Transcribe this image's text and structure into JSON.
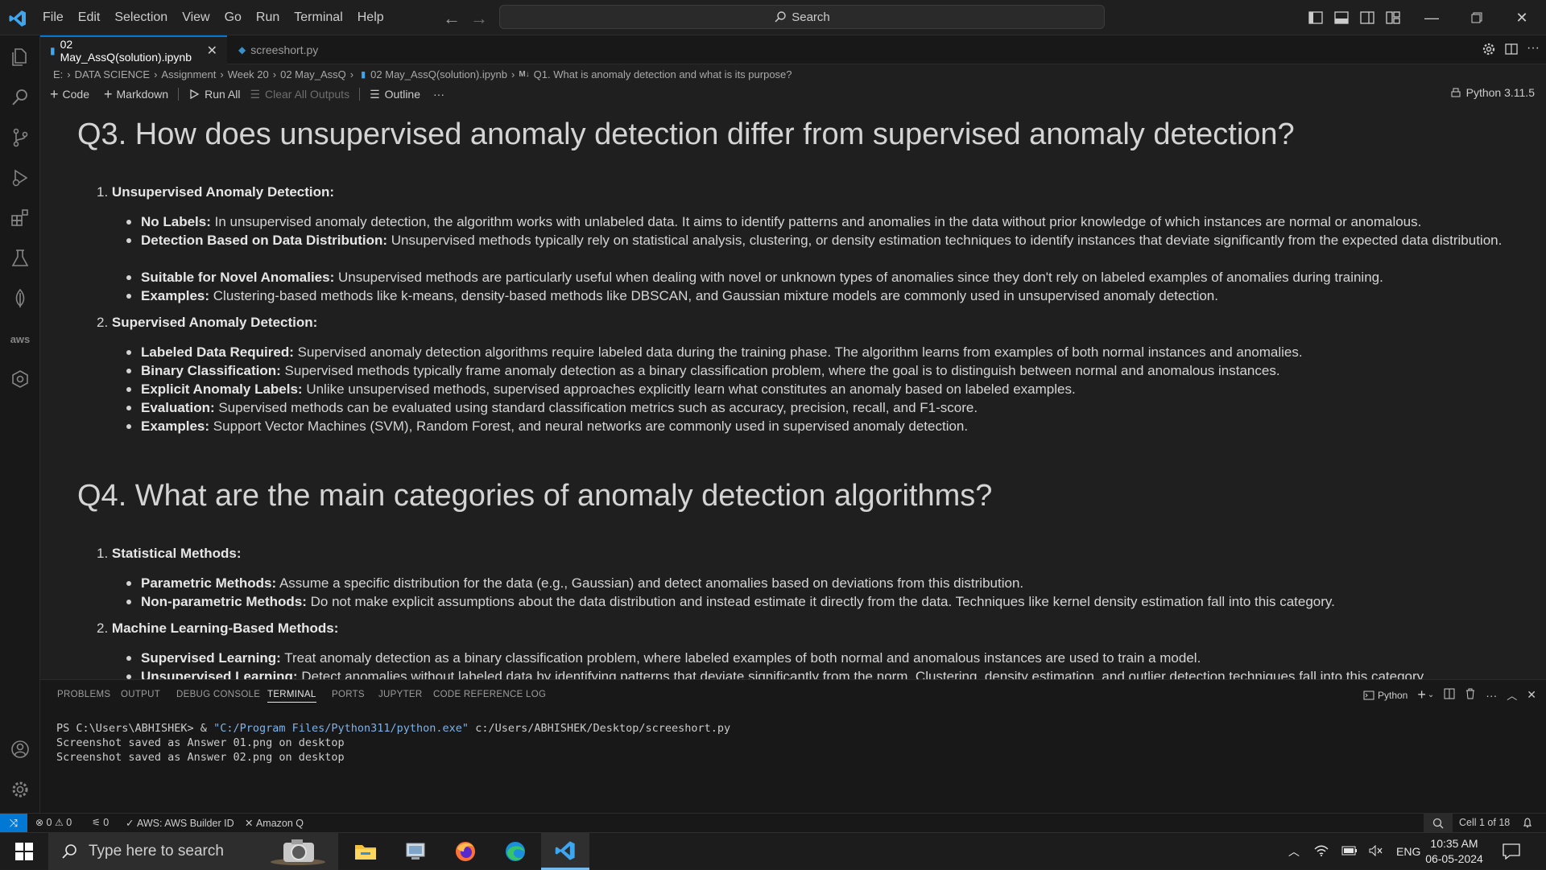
{
  "menu": [
    "File",
    "Edit",
    "Selection",
    "View",
    "Go",
    "Run",
    "Terminal",
    "Help"
  ],
  "search": {
    "label": "Search"
  },
  "tabs": [
    {
      "label": "02 May_AssQ(solution).ipynb"
    },
    {
      "label": "screeshort.py"
    }
  ],
  "breadcrumb": [
    "E:",
    "DATA SCIENCE",
    "Assignment",
    "Week 20",
    "02 May_AssQ",
    "02 May_AssQ(solution).ipynb",
    "Q1. What is anomaly detection and what is its purpose?"
  ],
  "breadcrumb_md_badge": "M↓",
  "toolbar": {
    "code": "Code",
    "markdown": "Markdown",
    "run_all": "Run All",
    "clear_outputs": "Clear All Outputs",
    "outline": "Outline",
    "more": "···",
    "kernel": "Python 3.11.5"
  },
  "content": {
    "q3": {
      "title": "Q3. How does unsupervised anomaly detection differ from supervised anomaly detection?",
      "sections": [
        {
          "num": "1.",
          "heading": "Unsupervised Anomaly Detection:",
          "items": [
            {
              "term": "No Labels:",
              "text": " In unsupervised anomaly detection, the algorithm works with unlabeled data. It aims to identify patterns and anomalies in the data without prior knowledge of which instances are normal or anomalous."
            },
            {
              "term": "Detection Based on Data Distribution:",
              "text": " Unsupervised methods typically rely on statistical analysis, clustering, or density estimation techniques to identify instances that deviate significantly from the expected data distribution."
            },
            {
              "term": "Suitable for Novel Anomalies:",
              "text": " Unsupervised methods are particularly useful when dealing with novel or unknown types of anomalies since they don't rely on labeled examples of anomalies during training."
            },
            {
              "term": "Examples:",
              "text": " Clustering-based methods like k-means, density-based methods like DBSCAN, and Gaussian mixture models are commonly used in unsupervised anomaly detection."
            }
          ]
        },
        {
          "num": "2.",
          "heading": "Supervised Anomaly Detection:",
          "items": [
            {
              "term": "Labeled Data Required:",
              "text": " Supervised anomaly detection algorithms require labeled data during the training phase. The algorithm learns from examples of both normal instances and anomalies."
            },
            {
              "term": "Binary Classification:",
              "text": " Supervised methods typically frame anomaly detection as a binary classification problem, where the goal is to distinguish between normal and anomalous instances."
            },
            {
              "term": "Explicit Anomaly Labels:",
              "text": " Unlike unsupervised methods, supervised approaches explicitly learn what constitutes an anomaly based on labeled examples."
            },
            {
              "term": "Evaluation:",
              "text": " Supervised methods can be evaluated using standard classification metrics such as accuracy, precision, recall, and F1-score."
            },
            {
              "term": "Examples:",
              "text": " Support Vector Machines (SVM), Random Forest, and neural networks are commonly used in supervised anomaly detection."
            }
          ]
        }
      ]
    },
    "q4": {
      "title": "Q4. What are the main categories of anomaly detection algorithms?",
      "sections": [
        {
          "num": "1.",
          "heading": "Statistical Methods:",
          "items": [
            {
              "term": "Parametric Methods:",
              "text": " Assume a specific distribution for the data (e.g., Gaussian) and detect anomalies based on deviations from this distribution."
            },
            {
              "term": "Non-parametric Methods:",
              "text": " Do not make explicit assumptions about the data distribution and instead estimate it directly from the data. Techniques like kernel density estimation fall into this category."
            }
          ]
        },
        {
          "num": "2.",
          "heading": "Machine Learning-Based Methods:",
          "items": [
            {
              "term": "Supervised Learning:",
              "text": " Treat anomaly detection as a binary classification problem, where labeled examples of both normal and anomalous instances are used to train a model."
            },
            {
              "term": "Unsupervised Learning:",
              "text": " Detect anomalies without labeled data by identifying patterns that deviate significantly from the norm. Clustering, density estimation, and outlier detection techniques fall into this category."
            }
          ]
        }
      ]
    }
  },
  "panel": {
    "tabs": [
      "PROBLEMS",
      "OUTPUT",
      "DEBUG CONSOLE",
      "TERMINAL",
      "PORTS",
      "JUPYTER",
      "CODE REFERENCE LOG"
    ],
    "shell": "Python",
    "terminal": {
      "prompt": "PS C:\\Users\\ABHISHEK> & ",
      "exe": "\"C:/Program Files/Python311/python.exe\"",
      "script": " c:/Users/ABHISHEK/Desktop/screeshort.py",
      "lines": [
        "Screenshot saved as Answer 01.png on desktop",
        "Screenshot saved as Answer 02.png on desktop"
      ]
    }
  },
  "status": {
    "errors": "0",
    "warnings": "0",
    "ports": "0",
    "aws": "AWS: AWS Builder ID",
    "amazonq": "Amazon Q",
    "cell": "Cell 1 of 18"
  },
  "taskbar": {
    "search_placeholder": "Type here to search",
    "lang": "ENG",
    "time": "10:35 AM",
    "date": "06-05-2024"
  },
  "colors": {
    "accent": "#0078d4",
    "background": "#1f1f1f",
    "sidebar": "#181818"
  }
}
